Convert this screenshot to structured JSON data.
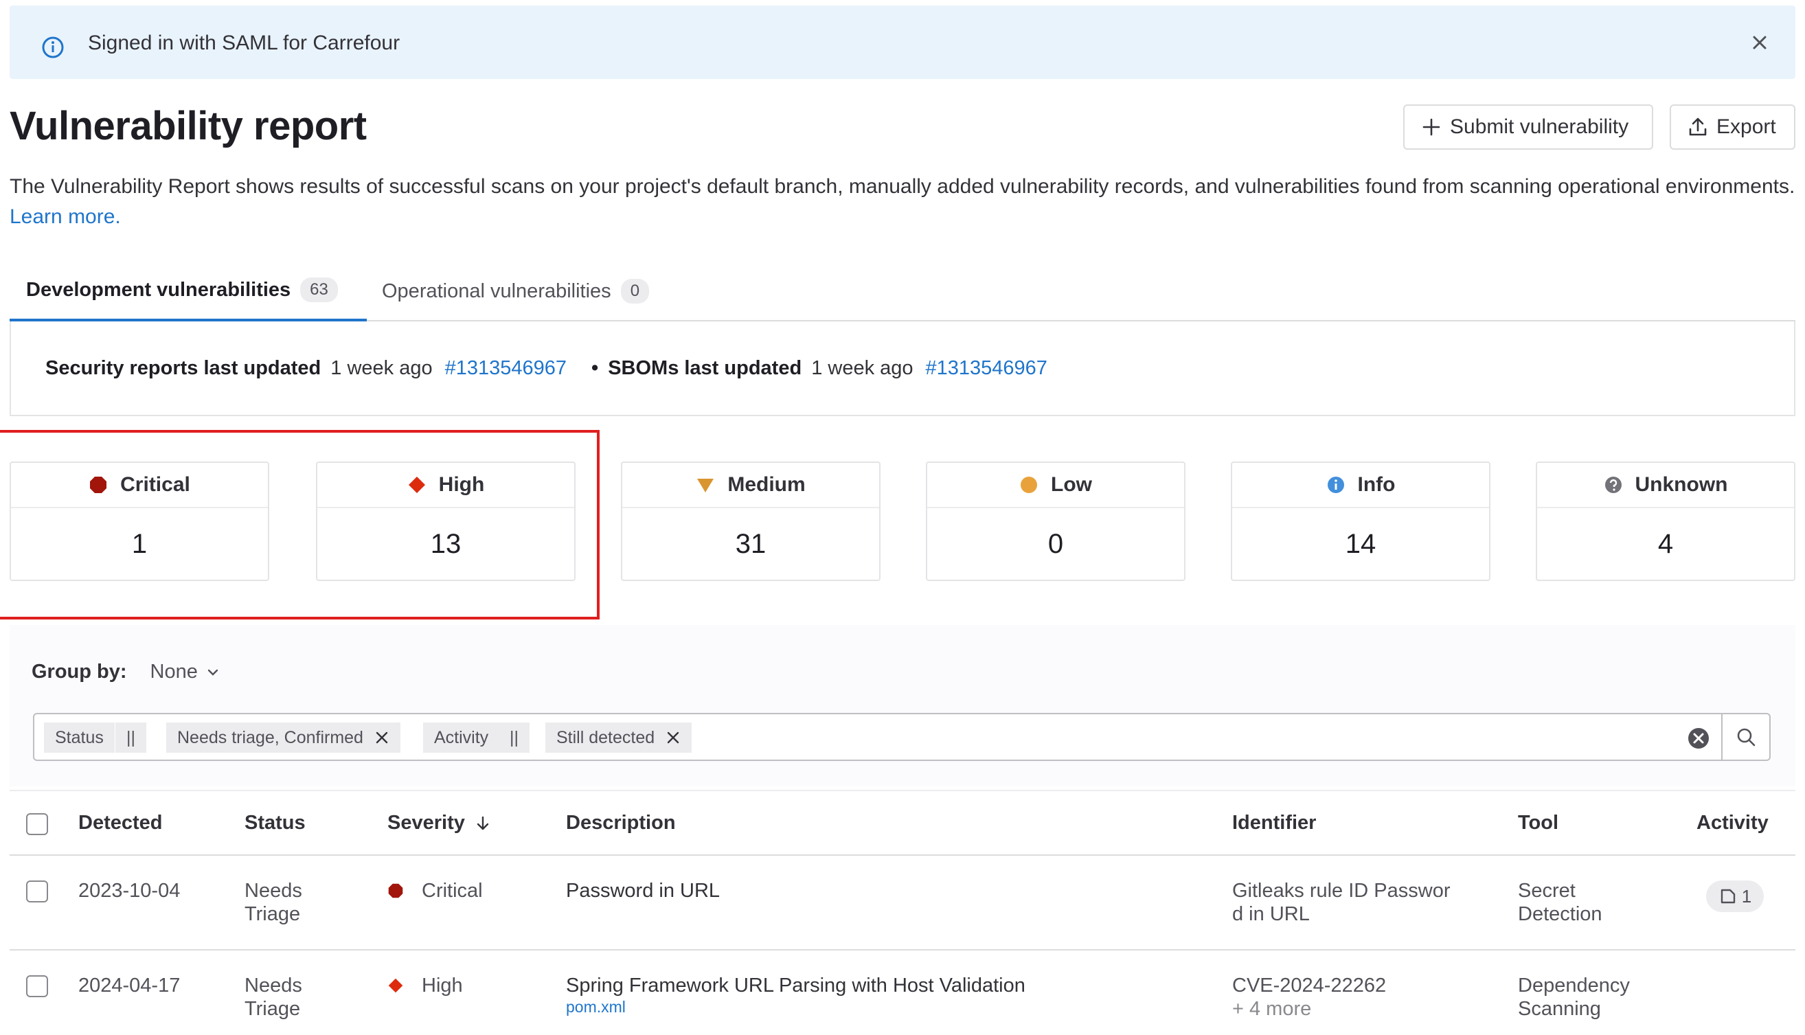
{
  "banner": {
    "message": "Signed in with SAML for Carrefour",
    "icon": "info-icon",
    "close_icon": "close-icon"
  },
  "page": {
    "title": "Vulnerability report",
    "description": "The Vulnerability Report shows results of successful scans on your project's default branch, manually added vulnerability records, and vulnerabilities found from scanning operational environments.",
    "learn_more": "Learn more."
  },
  "actions": {
    "submit_label": "Submit vulnerability",
    "export_label": "Export"
  },
  "tabs": [
    {
      "label": "Development vulnerabilities",
      "count": "63",
      "active": true
    },
    {
      "label": "Operational vulnerabilities",
      "count": "0",
      "active": false
    }
  ],
  "updated": {
    "security_label": "Security reports last updated",
    "security_time": "1 week ago",
    "security_pipeline": "#1313546967",
    "separator": "•",
    "sbom_label": "SBOMs last updated",
    "sbom_time": "1 week ago",
    "sbom_pipeline": "#1313546967"
  },
  "severity_counts": [
    {
      "label": "Critical",
      "value": "1",
      "color": "#a1150b",
      "icon": "critical-icon"
    },
    {
      "label": "High",
      "value": "13",
      "color": "#dd2b0e",
      "icon": "high-icon"
    },
    {
      "label": "Medium",
      "value": "31",
      "color": "#d99530",
      "icon": "medium-icon"
    },
    {
      "label": "Low",
      "value": "0",
      "color": "#e9a23b",
      "icon": "low-icon"
    },
    {
      "label": "Info",
      "value": "14",
      "color": "#428fdc",
      "icon": "info-icon"
    },
    {
      "label": "Unknown",
      "value": "4",
      "color": "#737278",
      "icon": "unknown-icon"
    }
  ],
  "filters": {
    "group_by_label": "Group by:",
    "group_by_value": "None",
    "tokens": [
      {
        "text": "Status"
      },
      {
        "text": "||"
      },
      {
        "text": "Needs triage, Confirmed"
      },
      {
        "text": "Activity"
      },
      {
        "text": "||"
      },
      {
        "text": "Still detected"
      }
    ]
  },
  "table": {
    "headers": {
      "detected": "Detected",
      "status": "Status",
      "severity": "Severity",
      "description": "Description",
      "identifier": "Identifier",
      "tool": "Tool",
      "activity": "Activity"
    },
    "rows": [
      {
        "detected": "2023-10-04",
        "status_1": "Needs",
        "status_2": "Triage",
        "severity": "Critical",
        "description": "Password in URL",
        "file": "",
        "identifier_1": "Gitleaks rule ID Passwor",
        "identifier_2": "d in URL",
        "tool_1": "Secret",
        "tool_2": "Detection",
        "activity_count": "1"
      },
      {
        "detected": "2024-04-17",
        "status_1": "Needs",
        "status_2": "Triage",
        "severity": "High",
        "description": "Spring Framework URL Parsing with Host Validation",
        "file": "pom.xml",
        "identifier_1": "CVE-2024-22262",
        "identifier_2": "+ 4 more",
        "tool_1": "Dependency",
        "tool_2": "Scanning",
        "activity_count": ""
      }
    ]
  }
}
